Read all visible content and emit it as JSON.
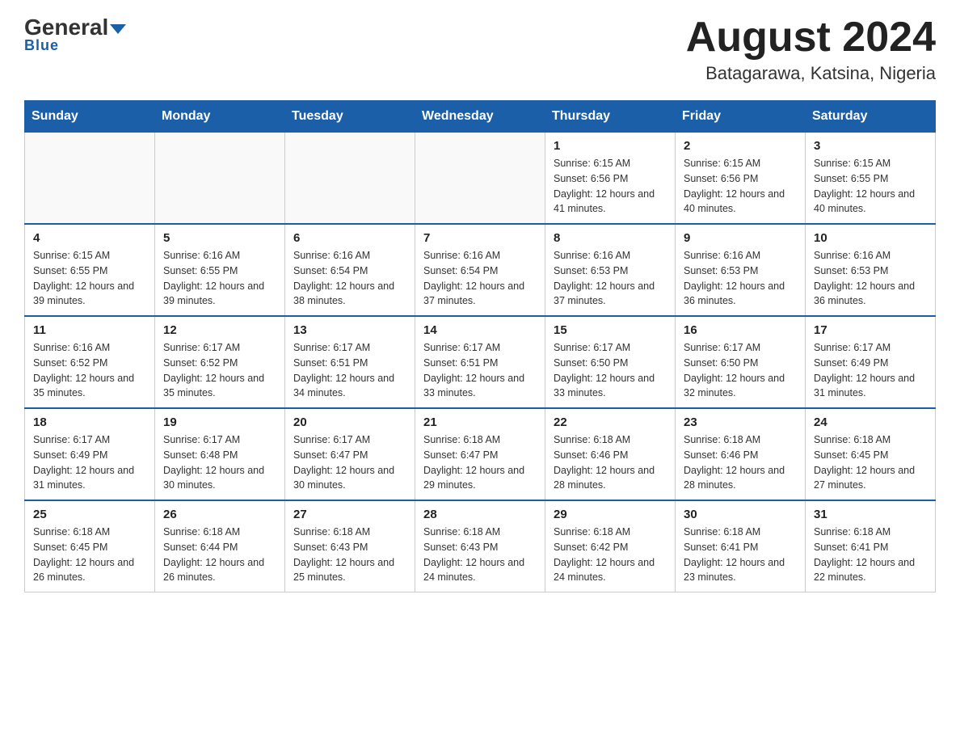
{
  "header": {
    "logo_general": "General",
    "logo_blue": "Blue",
    "month_year": "August 2024",
    "location": "Batagarawa, Katsina, Nigeria"
  },
  "days_of_week": [
    "Sunday",
    "Monday",
    "Tuesday",
    "Wednesday",
    "Thursday",
    "Friday",
    "Saturday"
  ],
  "weeks": [
    {
      "cells": [
        {
          "day": "",
          "info": ""
        },
        {
          "day": "",
          "info": ""
        },
        {
          "day": "",
          "info": ""
        },
        {
          "day": "",
          "info": ""
        },
        {
          "day": "1",
          "info": "Sunrise: 6:15 AM\nSunset: 6:56 PM\nDaylight: 12 hours and 41 minutes."
        },
        {
          "day": "2",
          "info": "Sunrise: 6:15 AM\nSunset: 6:56 PM\nDaylight: 12 hours and 40 minutes."
        },
        {
          "day": "3",
          "info": "Sunrise: 6:15 AM\nSunset: 6:55 PM\nDaylight: 12 hours and 40 minutes."
        }
      ]
    },
    {
      "cells": [
        {
          "day": "4",
          "info": "Sunrise: 6:15 AM\nSunset: 6:55 PM\nDaylight: 12 hours and 39 minutes."
        },
        {
          "day": "5",
          "info": "Sunrise: 6:16 AM\nSunset: 6:55 PM\nDaylight: 12 hours and 39 minutes."
        },
        {
          "day": "6",
          "info": "Sunrise: 6:16 AM\nSunset: 6:54 PM\nDaylight: 12 hours and 38 minutes."
        },
        {
          "day": "7",
          "info": "Sunrise: 6:16 AM\nSunset: 6:54 PM\nDaylight: 12 hours and 37 minutes."
        },
        {
          "day": "8",
          "info": "Sunrise: 6:16 AM\nSunset: 6:53 PM\nDaylight: 12 hours and 37 minutes."
        },
        {
          "day": "9",
          "info": "Sunrise: 6:16 AM\nSunset: 6:53 PM\nDaylight: 12 hours and 36 minutes."
        },
        {
          "day": "10",
          "info": "Sunrise: 6:16 AM\nSunset: 6:53 PM\nDaylight: 12 hours and 36 minutes."
        }
      ]
    },
    {
      "cells": [
        {
          "day": "11",
          "info": "Sunrise: 6:16 AM\nSunset: 6:52 PM\nDaylight: 12 hours and 35 minutes."
        },
        {
          "day": "12",
          "info": "Sunrise: 6:17 AM\nSunset: 6:52 PM\nDaylight: 12 hours and 35 minutes."
        },
        {
          "day": "13",
          "info": "Sunrise: 6:17 AM\nSunset: 6:51 PM\nDaylight: 12 hours and 34 minutes."
        },
        {
          "day": "14",
          "info": "Sunrise: 6:17 AM\nSunset: 6:51 PM\nDaylight: 12 hours and 33 minutes."
        },
        {
          "day": "15",
          "info": "Sunrise: 6:17 AM\nSunset: 6:50 PM\nDaylight: 12 hours and 33 minutes."
        },
        {
          "day": "16",
          "info": "Sunrise: 6:17 AM\nSunset: 6:50 PM\nDaylight: 12 hours and 32 minutes."
        },
        {
          "day": "17",
          "info": "Sunrise: 6:17 AM\nSunset: 6:49 PM\nDaylight: 12 hours and 31 minutes."
        }
      ]
    },
    {
      "cells": [
        {
          "day": "18",
          "info": "Sunrise: 6:17 AM\nSunset: 6:49 PM\nDaylight: 12 hours and 31 minutes."
        },
        {
          "day": "19",
          "info": "Sunrise: 6:17 AM\nSunset: 6:48 PM\nDaylight: 12 hours and 30 minutes."
        },
        {
          "day": "20",
          "info": "Sunrise: 6:17 AM\nSunset: 6:47 PM\nDaylight: 12 hours and 30 minutes."
        },
        {
          "day": "21",
          "info": "Sunrise: 6:18 AM\nSunset: 6:47 PM\nDaylight: 12 hours and 29 minutes."
        },
        {
          "day": "22",
          "info": "Sunrise: 6:18 AM\nSunset: 6:46 PM\nDaylight: 12 hours and 28 minutes."
        },
        {
          "day": "23",
          "info": "Sunrise: 6:18 AM\nSunset: 6:46 PM\nDaylight: 12 hours and 28 minutes."
        },
        {
          "day": "24",
          "info": "Sunrise: 6:18 AM\nSunset: 6:45 PM\nDaylight: 12 hours and 27 minutes."
        }
      ]
    },
    {
      "cells": [
        {
          "day": "25",
          "info": "Sunrise: 6:18 AM\nSunset: 6:45 PM\nDaylight: 12 hours and 26 minutes."
        },
        {
          "day": "26",
          "info": "Sunrise: 6:18 AM\nSunset: 6:44 PM\nDaylight: 12 hours and 26 minutes."
        },
        {
          "day": "27",
          "info": "Sunrise: 6:18 AM\nSunset: 6:43 PM\nDaylight: 12 hours and 25 minutes."
        },
        {
          "day": "28",
          "info": "Sunrise: 6:18 AM\nSunset: 6:43 PM\nDaylight: 12 hours and 24 minutes."
        },
        {
          "day": "29",
          "info": "Sunrise: 6:18 AM\nSunset: 6:42 PM\nDaylight: 12 hours and 24 minutes."
        },
        {
          "day": "30",
          "info": "Sunrise: 6:18 AM\nSunset: 6:41 PM\nDaylight: 12 hours and 23 minutes."
        },
        {
          "day": "31",
          "info": "Sunrise: 6:18 AM\nSunset: 6:41 PM\nDaylight: 12 hours and 22 minutes."
        }
      ]
    }
  ]
}
